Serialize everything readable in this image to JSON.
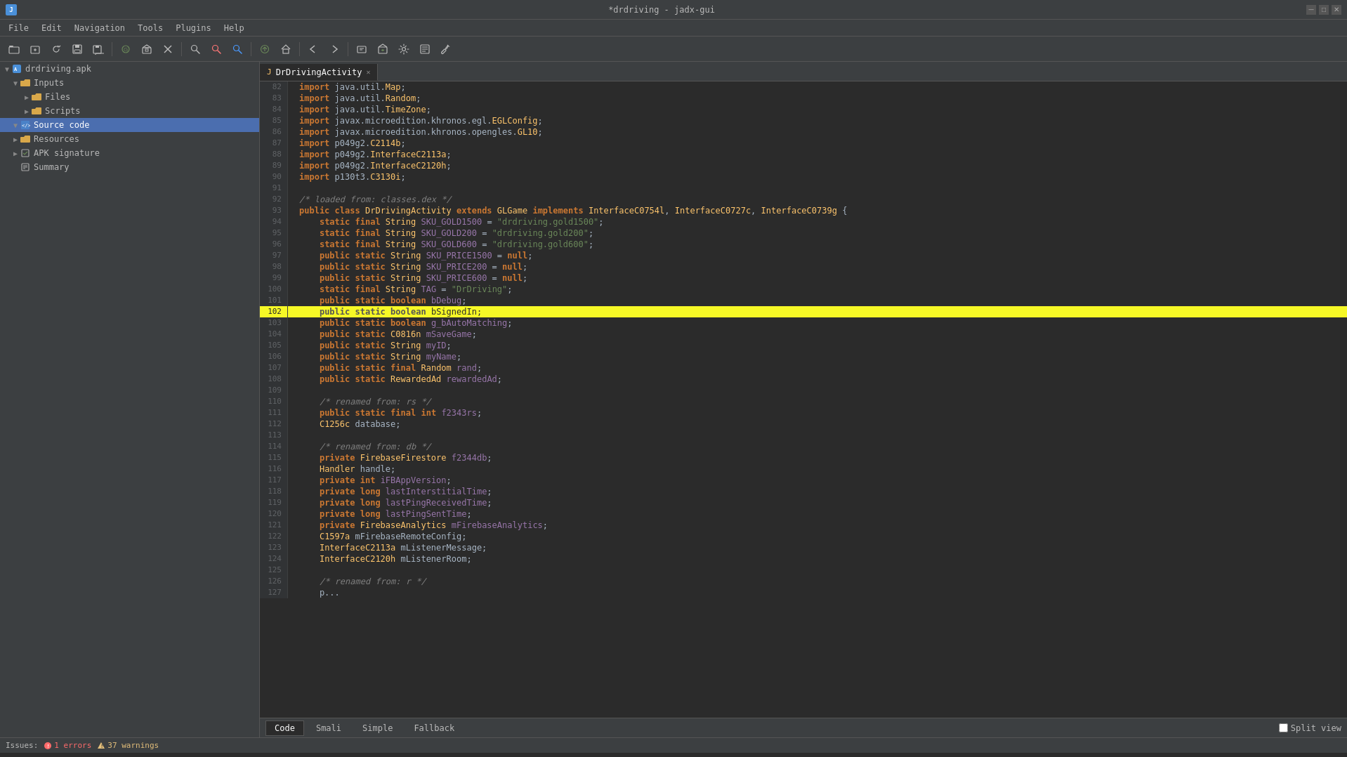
{
  "titlebar": {
    "title": "*drdriving - jadx-gui",
    "app_icon": "J"
  },
  "menubar": {
    "items": [
      "File",
      "Edit",
      "Navigation",
      "Tools",
      "Plugins",
      "Help"
    ]
  },
  "toolbar": {
    "buttons": [
      {
        "name": "open",
        "icon": "📂"
      },
      {
        "name": "add-files",
        "icon": "➕"
      },
      {
        "name": "reload",
        "icon": "🔄"
      },
      {
        "name": "save",
        "icon": "💾"
      },
      {
        "name": "save-all",
        "icon": "📦"
      },
      {
        "name": "export-gradle",
        "icon": "📤"
      },
      {
        "name": "close",
        "icon": "✕"
      },
      {
        "name": "search",
        "icon": "🔍"
      },
      {
        "name": "find-class",
        "icon": "🔎"
      },
      {
        "name": "find-usage",
        "icon": "🔬"
      },
      {
        "name": "decompile",
        "icon": "⚙"
      },
      {
        "name": "home",
        "icon": "🏠"
      },
      {
        "name": "back",
        "icon": "◀"
      },
      {
        "name": "forward",
        "icon": "▶"
      },
      {
        "name": "goto",
        "icon": "↳"
      },
      {
        "name": "package",
        "icon": "📦"
      },
      {
        "name": "settings",
        "icon": "⚙"
      },
      {
        "name": "log",
        "icon": "📋"
      },
      {
        "name": "wrench",
        "icon": "🔧"
      }
    ]
  },
  "sidebar": {
    "root_label": "drdriving.apk",
    "items": [
      {
        "label": "Inputs",
        "type": "folder",
        "indent": 1,
        "expanded": true
      },
      {
        "label": "Files",
        "type": "folder",
        "indent": 2,
        "expanded": false
      },
      {
        "label": "Scripts",
        "type": "folder",
        "indent": 2,
        "expanded": false
      },
      {
        "label": "Source code",
        "type": "source",
        "indent": 1,
        "expanded": true,
        "selected": true
      },
      {
        "label": "Resources",
        "type": "folder",
        "indent": 1,
        "expanded": false
      },
      {
        "label": "APK signature",
        "type": "apk",
        "indent": 1,
        "expanded": false
      },
      {
        "label": "Summary",
        "type": "summary",
        "indent": 1,
        "expanded": false
      }
    ]
  },
  "editor": {
    "tab_label": "DrDrivingActivity",
    "lines": [
      {
        "num": 82,
        "content": "import java.util.Map;",
        "tokens": [
          {
            "t": "imp-kw",
            "v": "import"
          },
          {
            "t": "pkg",
            "v": " java.util."
          },
          {
            "t": "cls",
            "v": "Map"
          },
          {
            "t": "pkg",
            "v": ";"
          }
        ]
      },
      {
        "num": 83,
        "content": "import java.util.Random;",
        "tokens": [
          {
            "t": "imp-kw",
            "v": "import"
          },
          {
            "t": "pkg",
            "v": " java.util."
          },
          {
            "t": "cls",
            "v": "Random"
          },
          {
            "t": "pkg",
            "v": ";"
          }
        ]
      },
      {
        "num": 84,
        "content": "import java.util.TimeZone;",
        "tokens": [
          {
            "t": "imp-kw",
            "v": "import"
          },
          {
            "t": "pkg",
            "v": " java.util."
          },
          {
            "t": "cls",
            "v": "TimeZone"
          },
          {
            "t": "pkg",
            "v": ";"
          }
        ]
      },
      {
        "num": 85,
        "content": "import javax.microedition.khronos.egl.EGLConfig;",
        "tokens": [
          {
            "t": "imp-kw",
            "v": "import"
          },
          {
            "t": "pkg",
            "v": " javax.microedition.khronos.egl."
          },
          {
            "t": "cls",
            "v": "EGLConfig"
          },
          {
            "t": "pkg",
            "v": ";"
          }
        ]
      },
      {
        "num": 86,
        "content": "import javax.microedition.khronos.opengles.GL10;",
        "tokens": [
          {
            "t": "imp-kw",
            "v": "import"
          },
          {
            "t": "pkg",
            "v": " javax.microedition.khronos.opengles."
          },
          {
            "t": "cls",
            "v": "GL10"
          },
          {
            "t": "pkg",
            "v": ";"
          }
        ]
      },
      {
        "num": 87,
        "content": "import p049g2.C2114b;",
        "tokens": [
          {
            "t": "imp-kw",
            "v": "import"
          },
          {
            "t": "pkg",
            "v": " p049g2."
          },
          {
            "t": "cls",
            "v": "C2114b"
          },
          {
            "t": "pkg",
            "v": ";"
          }
        ]
      },
      {
        "num": 88,
        "content": "import p049g2.InterfaceC2113a;",
        "tokens": [
          {
            "t": "imp-kw",
            "v": "import"
          },
          {
            "t": "pkg",
            "v": " p049g2."
          },
          {
            "t": "cls",
            "v": "InterfaceC2113a"
          },
          {
            "t": "pkg",
            "v": ";"
          }
        ]
      },
      {
        "num": 89,
        "content": "import p049g2.InterfaceC2120h;",
        "tokens": [
          {
            "t": "imp-kw",
            "v": "import"
          },
          {
            "t": "pkg",
            "v": " p049g2."
          },
          {
            "t": "cls",
            "v": "InterfaceC2120h"
          },
          {
            "t": "pkg",
            "v": ";"
          }
        ]
      },
      {
        "num": 90,
        "content": "import p130t3.C3130i;",
        "tokens": [
          {
            "t": "imp-kw",
            "v": "import"
          },
          {
            "t": "pkg",
            "v": " p130t3."
          },
          {
            "t": "cls",
            "v": "C3130i"
          },
          {
            "t": "pkg",
            "v": ";"
          }
        ]
      },
      {
        "num": 91,
        "content": ""
      },
      {
        "num": 92,
        "content": "/* loaded from: classes.dex */"
      },
      {
        "num": 93,
        "content": "public class DrDrivingActivity extends GLGame implements InterfaceC0754l, InterfaceC0727c, InterfaceC0739g {"
      },
      {
        "num": 94,
        "content": "    static final String SKU_GOLD1500 = \"drdriving.gold1500\";"
      },
      {
        "num": 95,
        "content": "    static final String SKU_GOLD200 = \"drdriving.gold200\";"
      },
      {
        "num": 96,
        "content": "    static final String SKU_GOLD600 = \"drdriving.gold600\";"
      },
      {
        "num": 97,
        "content": "    public static String SKU_PRICE1500 = null;"
      },
      {
        "num": 98,
        "content": "    public static String SKU_PRICE200 = null;"
      },
      {
        "num": 99,
        "content": "    public static String SKU_PRICE600 = null;"
      },
      {
        "num": 100,
        "content": "    static final String TAG = \"DrDriving\";"
      },
      {
        "num": 101,
        "content": "    public static boolean bDebug;"
      },
      {
        "num": 102,
        "content": "    public static boolean bSignedIn;",
        "highlighted": true
      },
      {
        "num": 103,
        "content": "    public static boolean g_bAutoMatching;"
      },
      {
        "num": 104,
        "content": "    public static C0816n mSaveGame;"
      },
      {
        "num": 105,
        "content": "    public static String myID;"
      },
      {
        "num": 106,
        "content": "    public static String myName;"
      },
      {
        "num": 107,
        "content": "    public static final Random rand;"
      },
      {
        "num": 108,
        "content": "    public static RewardedAd rewardedAd;"
      },
      {
        "num": 109,
        "content": ""
      },
      {
        "num": 110,
        "content": "    /* renamed from: rs */"
      },
      {
        "num": 111,
        "content": "    public static final int f2343rs;"
      },
      {
        "num": 112,
        "content": "    C1256c database;"
      },
      {
        "num": 113,
        "content": ""
      },
      {
        "num": 114,
        "content": "    /* renamed from: db */"
      },
      {
        "num": 115,
        "content": "    private FirebaseFirestore f2344db;"
      },
      {
        "num": 116,
        "content": "    Handler handle;"
      },
      {
        "num": 117,
        "content": "    private int iFBAppVersion;"
      },
      {
        "num": 118,
        "content": "    private long lastInterstitialTime;"
      },
      {
        "num": 119,
        "content": "    private long lastPingReceivedTime;"
      },
      {
        "num": 120,
        "content": "    private long lastPingSentTime;"
      },
      {
        "num": 121,
        "content": "    private FirebaseAnalytics mFirebaseAnalytics;"
      },
      {
        "num": 122,
        "content": "    C1597a mFirebaseRemoteConfig;"
      },
      {
        "num": 123,
        "content": "    InterfaceC2113a mListenerMessage;"
      },
      {
        "num": 124,
        "content": "    InterfaceC2120h mListenerRoom;"
      },
      {
        "num": 125,
        "content": ""
      },
      {
        "num": 126,
        "content": "    /* renamed from: r */"
      },
      {
        "num": 127,
        "content": "    p..."
      }
    ]
  },
  "bottom_tabs": {
    "tabs": [
      "Code",
      "Smali",
      "Simple",
      "Fallback"
    ],
    "active": "Code",
    "split_view_label": "Split view"
  },
  "statusbar": {
    "issues_label": "Issues:",
    "errors": "1 errors",
    "warnings": "37 warnings"
  }
}
